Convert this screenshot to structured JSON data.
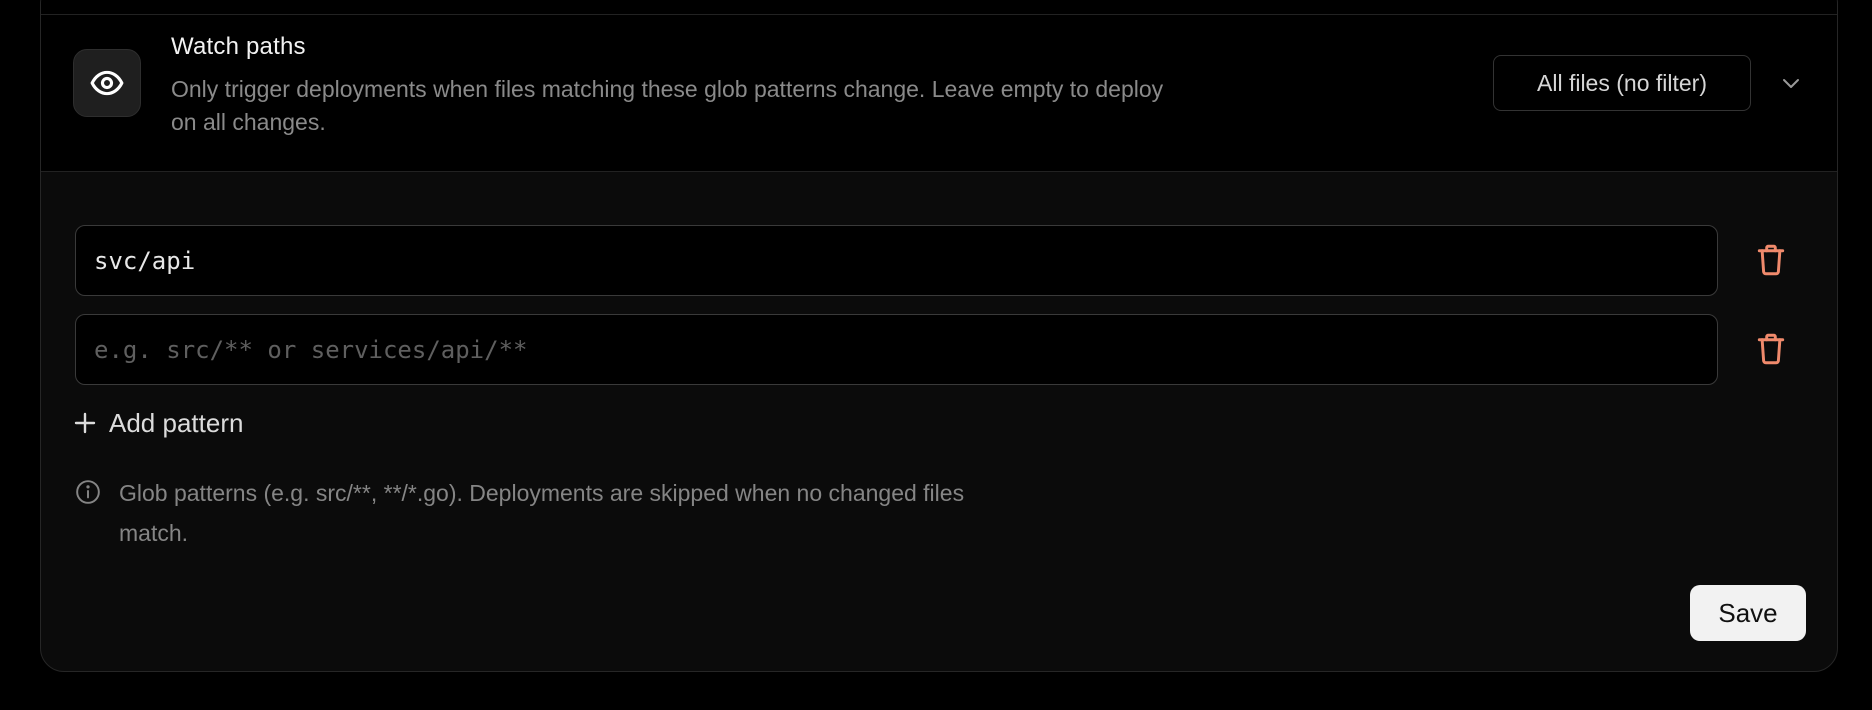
{
  "watch_paths": {
    "title": "Watch paths",
    "description": "Only trigger deployments when files matching these glob patterns change. Leave empty to deploy on all changes.",
    "filter_select": {
      "selected": "All files (no filter)"
    },
    "icon": "eye-icon"
  },
  "patterns": {
    "items": [
      {
        "value": "svc/api",
        "placeholder": ""
      },
      {
        "value": "",
        "placeholder": "e.g. src/** or services/api/**"
      }
    ],
    "add_label": "Add pattern"
  },
  "info": {
    "text": "Glob patterns (e.g. src/**, **/*.go). Deployments are skipped when no changed files match."
  },
  "actions": {
    "save_label": "Save"
  },
  "colors": {
    "background": "#000000",
    "panel": "#0b0b0b",
    "border": "#262626",
    "trash_accent": "#f08a6c",
    "save_bg": "#f2f2f2"
  }
}
